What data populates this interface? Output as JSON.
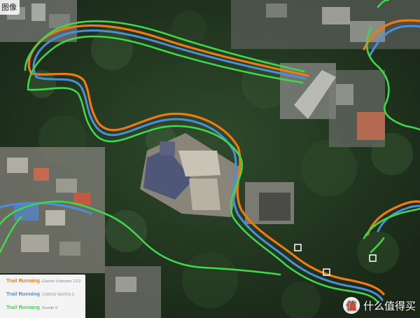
{
  "tab_label": "图像",
  "legend": [
    {
      "activity": "Trail Running",
      "device": "Garmin Unknown 1112",
      "color": "#f07a12"
    },
    {
      "activity": "Trail Running",
      "device": "COROS VERTIX 2",
      "color": "#4c8fd8"
    },
    {
      "activity": "Trail Running",
      "device": "Suunto 9",
      "color": "#3ed84a"
    }
  ],
  "watermark": {
    "badge": "值",
    "text": "什么值得买"
  },
  "colors": {
    "garmin": "#f07a12",
    "coros": "#4c8fd8",
    "suunto": "#3ed84a"
  }
}
